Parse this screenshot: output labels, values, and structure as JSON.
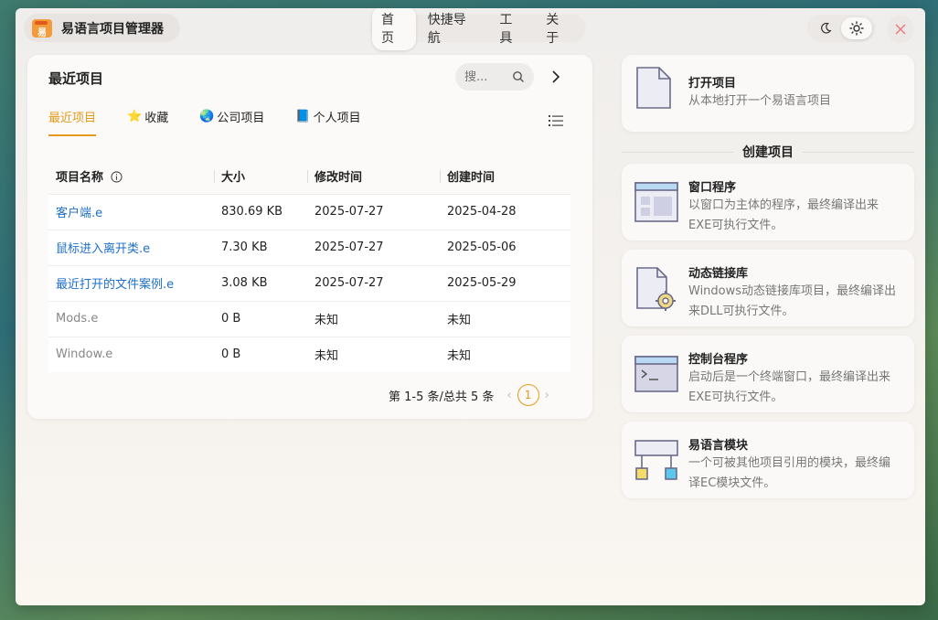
{
  "app": {
    "title": "易语言项目管理器",
    "logo_text": "易"
  },
  "nav": {
    "items": [
      "首页",
      "快捷导航",
      "工具",
      "关于"
    ],
    "active": 0
  },
  "theme": {
    "dark_icon": "moon-icon",
    "light_icon": "sun-icon",
    "close_icon": "close-icon"
  },
  "recent": {
    "title": "最近项目",
    "search_placeholder": "搜...",
    "tabs": [
      {
        "label": "最近项目",
        "icon": ""
      },
      {
        "label": "收藏",
        "icon": "⭐"
      },
      {
        "label": "公司项目",
        "icon": "🌏"
      },
      {
        "label": "个人项目",
        "icon": "📘"
      }
    ],
    "columns": [
      "项目名称",
      "大小",
      "修改时间",
      "创建时间"
    ],
    "rows": [
      {
        "name": "客户端.e",
        "size": "830.69 KB",
        "modified": "2025-07-27",
        "created": "2025-04-28"
      },
      {
        "name": "鼠标进入离开类.e",
        "size": "7.30 KB",
        "modified": "2025-07-27",
        "created": "2025-05-06"
      },
      {
        "name": "最近打开的文件案例.e",
        "size": "3.08 KB",
        "modified": "2025-07-27",
        "created": "2025-05-29"
      },
      {
        "name": "Mods.e",
        "size": "0 B",
        "modified": "未知",
        "created": "未知"
      },
      {
        "name": "Window.e",
        "size": "0 B",
        "modified": "未知",
        "created": "未知"
      }
    ],
    "pager": {
      "summary": "第 1-5 条/总共 5 条",
      "current": "1"
    }
  },
  "open_card": {
    "title": "打开项目",
    "desc": "从本地打开一个易语言项目"
  },
  "create_section": "创建项目",
  "create_cards": [
    {
      "title": "窗口程序",
      "desc": "以窗口为主体的程序，最终编译出来EXE可执行文件。"
    },
    {
      "title": "动态链接库",
      "desc": "Windows动态链接库项目，最终编译出来DLL可执行文件。"
    },
    {
      "title": "控制台程序",
      "desc": "启动后是一个终端窗口，最终编译出来EXE可执行文件。"
    },
    {
      "title": "易语言模块",
      "desc": "一个可被其他项目引用的模块，最终编译EC模块文件。"
    }
  ],
  "colors": {
    "accent": "#e39a1a",
    "link": "#1e6fc8",
    "close": "#e57b7b"
  }
}
